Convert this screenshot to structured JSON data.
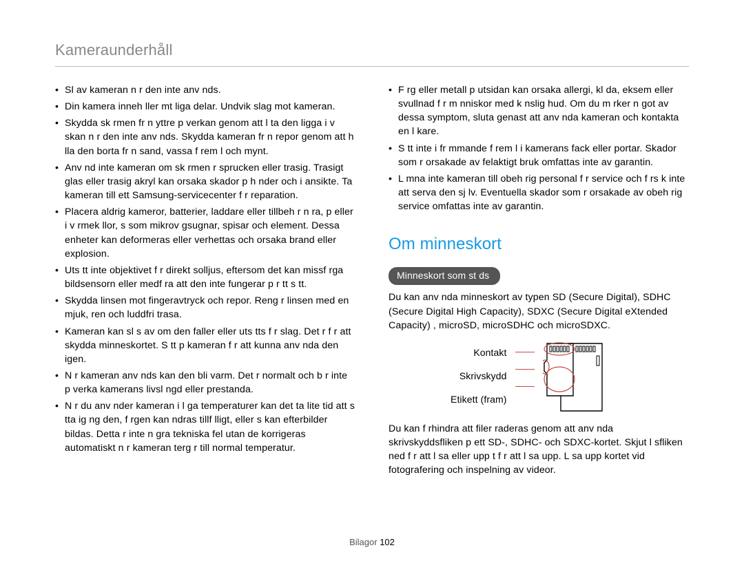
{
  "page_title": "Kameraunderhåll",
  "left_bullets": [
    "Sl  av kameran n r den inte anv nds.",
    "Din kamera inneh ller  mt liga delar. Undvik slag mot kameran.",
    "Skydda sk rmen fr n yttre p verkan genom att l ta den ligga i v skan n r den inte anv nds. Skydda kameran fr n repor genom att h lla den borta fr n sand, vassa f rem l och mynt.",
    "Anv nd inte kameran om sk rmen  r sprucken eller trasig. Trasigt glas eller trasig akryl kan orsaka skador p  h nder och i ansikte. Ta kameran till ett Samsung-servicecenter f r reparation.",
    "Placera aldrig kameror, batterier, laddare eller tillbeh r n ra, p  eller i v rmek llor, s som mikrov gsugnar, spisar och element. Dessa enheter kan deformeras eller  verhettas och orsaka brand eller explosion.",
    "Uts tt inte objektivet f r direkt solljus, eftersom det kan missf rga bildsensorn eller medf ra att den inte fungerar p  r tt s tt.",
    "Skydda linsen mot fingeravtryck och repor. Reng r linsen med en mjuk, ren och luddfri trasa.",
    "Kameran kan sl s av om den faller eller uts tts f r slag. Det  r f r att skydda minneskortet. S tt p  kameran f r att kunna anv nda den igen.",
    "N r kameran anv nds kan den bli varm. Det  r normalt och b r inte p verka kamerans livsl ngd eller prestanda.",
    "N r du anv nder kameran i l ga temperaturer kan det ta lite tid att s tta ig ng den, f rgen kan  ndras tillf lligt, eller s  kan efterbilder bildas. Detta  r inte n gra tekniska fel utan de korrigeras automatiskt n r kameran  terg r till normal temperatur."
  ],
  "right_bullets_top": [
    "F rg eller metall p  utsidan kan orsaka allergi, kl da, eksem eller svullnad f r m nniskor med k nslig hud. Om du m rker n got av dessa symptom, sluta genast att anv nda kameran och kontakta en l kare.",
    "S tt inte i fr mmande f rem l i kamerans fack eller portar. Skador som  r orsakade av felaktigt bruk omfattas inte av garantin.",
    "L mna inte kameran till obeh rig personal f r service och f rs k inte att serva den sj lv. Eventuella skador som  r orsakade av obeh rig service omfattas inte av garantin."
  ],
  "memory_heading": "Om minneskort",
  "memory_pill": "Minneskort som st ds",
  "memory_para1": "Du kan anv nda minneskort av typen SD (Secure Digital), SDHC (Secure Digital High Capacity), SDXC (Secure Digital eXtended Capacity) , microSD, microSDHC och microSDXC.",
  "sd_labels": {
    "contact": "Kontakt",
    "write_protect": "Skrivskydd",
    "label_front": "Etikett (fram)"
  },
  "memory_para2": "Du kan f rhindra att filer raderas genom att anv nda skrivskyddsfliken p  ett SD-, SDHC- och SDXC-kortet. Skjut l sfliken ned f r att l sa eller upp t f r att l sa upp. L sa upp kortet vid fotografering och inspelning av videor.",
  "footer_section": "Bilagor",
  "footer_page": "102"
}
